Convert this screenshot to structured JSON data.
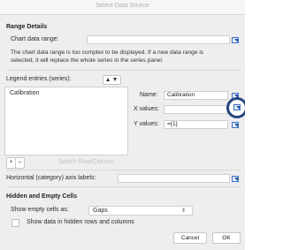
{
  "window": {
    "title": "Select Data Source"
  },
  "range": {
    "header": "Range Details",
    "chart_range_label": "Chart data range:",
    "chart_range_value": "",
    "description": "The chart data range is too complex to be displayed. If a new data range is selected, it will replace the whole series in the series panel."
  },
  "series": {
    "legend_label": "Legend entries (series):",
    "items": [
      "Calibration"
    ],
    "name_label": "Name:",
    "name_value": "Calibration",
    "x_label": "X values:",
    "x_value": "",
    "y_label": "Y values:",
    "y_value": "={1}",
    "add": "+",
    "remove": "–",
    "switch": "Switch Row/Column"
  },
  "axis": {
    "label": "Horizontal (category) axis labels:",
    "value": ""
  },
  "hidden": {
    "header": "Hidden and Empty Cells",
    "show_empty_label": "Show empty cells as:",
    "show_empty_value": "Gaps",
    "hidden_rows_label": "Show data in hidden rows and columns"
  },
  "buttons": {
    "cancel": "Cancel",
    "ok": "OK"
  },
  "colors": {
    "accent": "#2b5fa8"
  }
}
